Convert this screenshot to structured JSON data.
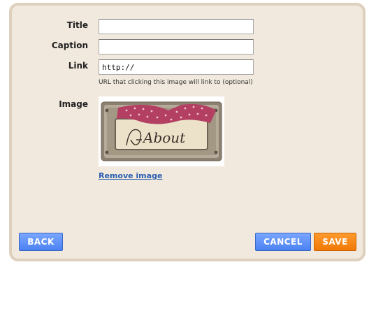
{
  "form": {
    "title_label": "Title",
    "caption_label": "Caption",
    "link_label": "Link",
    "image_label": "Image",
    "title_value": "",
    "caption_value": "",
    "link_value": "http://",
    "link_hint": "URL that clicking this image will link to (optional)",
    "image_text": "About",
    "remove_image_label": "Remove image"
  },
  "buttons": {
    "back": "BACK",
    "cancel": "CANCEL",
    "save": "SAVE"
  },
  "colors": {
    "dialog_bg": "#f1e9dd",
    "dialog_border": "#ddd1bd",
    "button_blue": "#5b8ff9",
    "button_orange": "#f5840f",
    "link_blue": "#2a5db0"
  }
}
